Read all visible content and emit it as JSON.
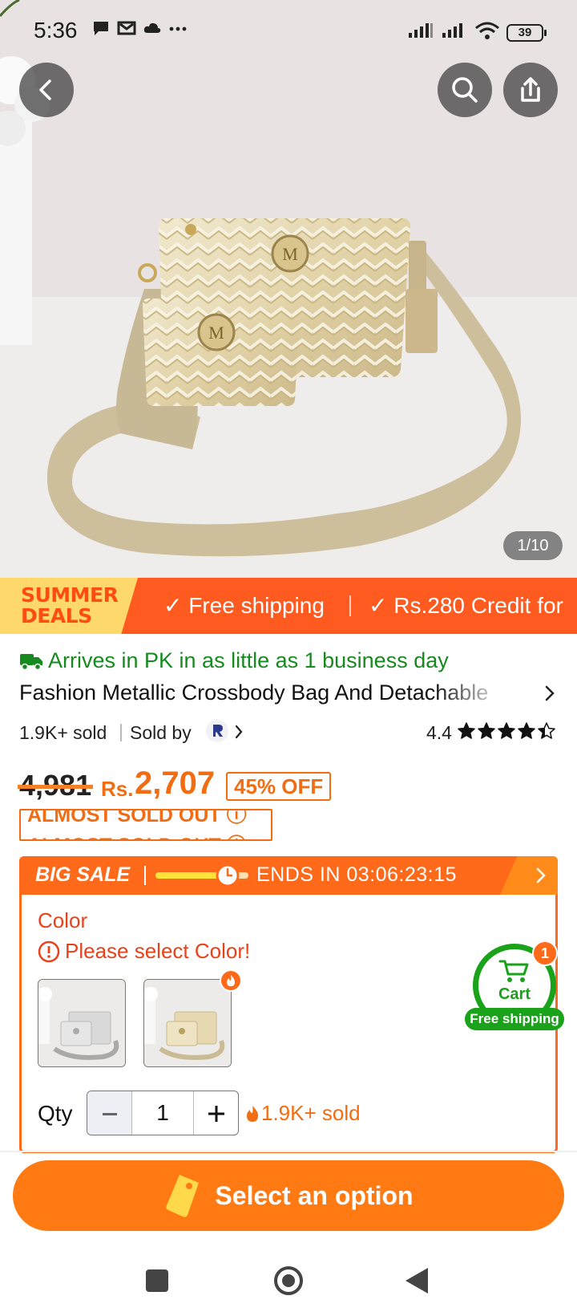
{
  "status_bar": {
    "time": "5:36",
    "battery": "39",
    "icons": [
      "chat-icon",
      "mail-icon",
      "cloud-icon",
      "more-dots-icon",
      "signal-icon",
      "signal-icon",
      "wifi-icon"
    ]
  },
  "hero": {
    "counter": "1/10",
    "buttons": [
      "back-icon",
      "search-icon",
      "share-icon"
    ]
  },
  "promo": {
    "badge_line1": "SUMMER",
    "badge_line2": "DEALS",
    "item1": "✓ Free shipping",
    "item2": "✓ Rs.280 Credit for"
  },
  "product": {
    "arrives": "Arrives in PK in as little as 1 business day",
    "title": "Fashion Metallic Crossbody Bag And Detachable",
    "sold": "1.9K+ sold",
    "sold_by": "Sold by",
    "rating": "4.4",
    "rating_value": 4.4,
    "old_price": "4,981",
    "currency": "Rs.",
    "price": "2,707",
    "discount": "45% OFF",
    "almost_sold_out": "ALMOST SOLD OUT ⓘ"
  },
  "sale": {
    "label": "BIG SALE",
    "ends": "ENDS IN 03:06:23:15",
    "progress": 0.72
  },
  "options": {
    "color_label": "Color",
    "warning": "Please select Color!",
    "swatches": [
      "silver",
      "gold"
    ]
  },
  "cart": {
    "count": "1",
    "label": "Cart",
    "free": "Free shipping"
  },
  "qty": {
    "label": "Qty",
    "value": "1",
    "sold": "1.9K+ sold"
  },
  "cta": {
    "label": "Select an option"
  },
  "colors": {
    "accent": "#ff7a12",
    "promo": "#ff5a1f",
    "green": "#1aa21a",
    "warning": "#e8421a"
  }
}
